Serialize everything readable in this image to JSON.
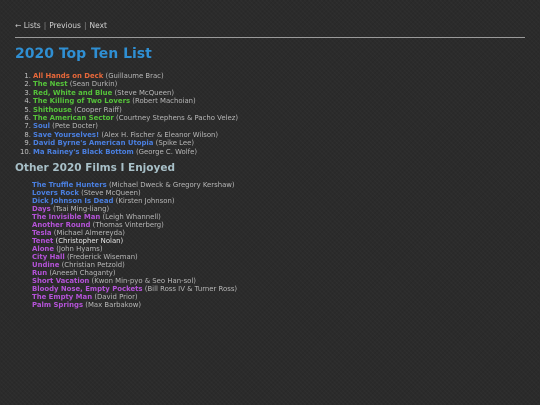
{
  "nav": {
    "arrow": "←",
    "lists": "Lists",
    "sep1": "|",
    "previous": "Previous",
    "sep2": "|",
    "next": "Next"
  },
  "page_title": "2020 Top Ten List",
  "top_ten": [
    {
      "num": "1.",
      "title": "All Hands on Deck",
      "director": "(Guillaume Brac)",
      "color": "#e8683a"
    },
    {
      "num": "2.",
      "title": "The Nest",
      "director": "(Sean Durkin)",
      "color": "#55c33a"
    },
    {
      "num": "3.",
      "title": "Red, White and Blue",
      "director": "(Steve McQueen)",
      "color": "#55c33a"
    },
    {
      "num": "4.",
      "title": "The Killing of Two Lovers",
      "director": "(Robert Machoian)",
      "color": "#55c33a"
    },
    {
      "num": "5.",
      "title": "Shithouse",
      "director": "(Cooper Raiff)",
      "color": "#55c33a"
    },
    {
      "num": "6.",
      "title": "The American Sector",
      "director": "(Courtney Stephens & Pacho Velez)",
      "color": "#55c33a"
    },
    {
      "num": "7.",
      "title": "Soul",
      "director": "(Pete Docter)",
      "color": "#4a7fe0"
    },
    {
      "num": "8.",
      "title": "Save Yourselves!",
      "director": "(Alex H. Fischer & Eleanor Wilson)",
      "color": "#4a7fe0"
    },
    {
      "num": "9.",
      "title": "David Byrne's American Utopia",
      "director": "(Spike Lee)",
      "color": "#4a7fe0"
    },
    {
      "num": "10.",
      "title": "Ma Rainey's Black Bottom",
      "director": "(George C. Wolfe)",
      "color": "#4a7fe0"
    }
  ],
  "other_heading": "Other 2020 Films I Enjoyed",
  "other_films": [
    {
      "title": "The Truffle Hunters",
      "director": "(Michael Dweck & Gregory Kershaw)",
      "color": "#4a7fe0"
    },
    {
      "title": "Lovers Rock",
      "director": "(Steve McQueen)",
      "color": "#4a7fe0"
    },
    {
      "title": "Dick Johnson Is Dead",
      "director": "(Kirsten Johnson)",
      "color": "#4a7fe0"
    },
    {
      "title": "Days",
      "director": "(Tsai Ming-liang)",
      "color": "#b452d8"
    },
    {
      "title": "The Invisible Man",
      "director": "(Leigh Whannell)",
      "color": "#b452d8"
    },
    {
      "title": "Another Round",
      "director": "(Thomas Vinterberg)",
      "color": "#b452d8"
    },
    {
      "title": "Tesla",
      "director": "(Michael Almereyda)",
      "color": "#b452d8"
    },
    {
      "title": "Tenet",
      "director": "(Christopher Nolan)",
      "color": "#b452d8",
      "highlight": true
    },
    {
      "title": "Alone",
      "director": "(John Hyams)",
      "color": "#b452d8"
    },
    {
      "title": "City Hall",
      "director": "(Frederick Wiseman)",
      "color": "#b452d8"
    },
    {
      "title": "Undine",
      "director": "(Christian Petzold)",
      "color": "#b452d8"
    },
    {
      "title": "Run",
      "director": "(Aneesh Chaganty)",
      "color": "#b452d8"
    },
    {
      "title": "Short Vacation",
      "director": "(Kwon Min-pyo & Seo Han-sol)",
      "color": "#b452d8"
    },
    {
      "title": "Bloody Nose, Empty Pockets",
      "director": "(Bill Ross IV & Turner Ross)",
      "color": "#b452d8"
    },
    {
      "title": "The Empty Man",
      "director": "(David Prior)",
      "color": "#b452d8"
    },
    {
      "title": "Palm Springs",
      "director": "(Max Barbakow)",
      "color": "#b452d8"
    }
  ]
}
